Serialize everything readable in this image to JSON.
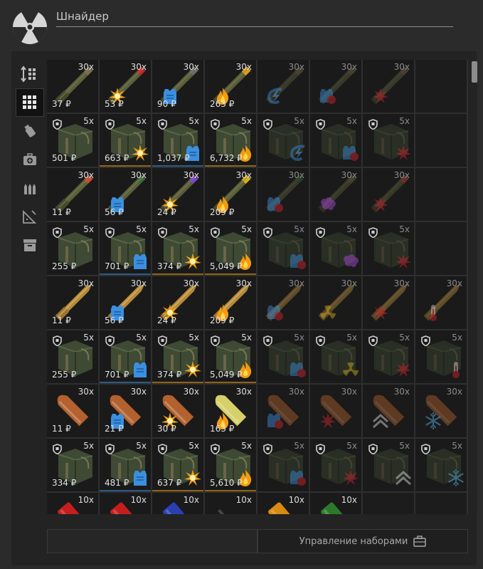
{
  "trader": {
    "name": "Шнайдер",
    "icon": "radiation-icon"
  },
  "sidebar": {
    "items": [
      {
        "name": "sort-icon",
        "active": false
      },
      {
        "name": "grid-view-icon",
        "active": true
      },
      {
        "name": "grenade-icon",
        "active": false
      },
      {
        "name": "medkit-icon",
        "active": false
      },
      {
        "name": "ammo-icon",
        "active": false
      },
      {
        "name": "ruler-icon",
        "active": false
      },
      {
        "name": "archive-icon",
        "active": false
      }
    ]
  },
  "footer": {
    "manage_sets_label": "Управление наборами",
    "icon": "briefcase-icon"
  },
  "colors": {
    "blue": "#3b8fe0",
    "red": "#d8252e",
    "orange": "#f2a012",
    "purple": "#b04be0",
    "yellow": "#d9b21d"
  },
  "grid": [
    {
      "type": "ammo",
      "count": "30x",
      "price": "37 ₽",
      "mod": "",
      "tip": "#7b6a48",
      "locked": false
    },
    {
      "type": "ammo",
      "count": "30x",
      "price": "53 ₽",
      "mod": "burst",
      "tip": "#c82525",
      "locked": false
    },
    {
      "type": "ammo",
      "count": "30x",
      "price": "90 ₽",
      "mod": "armor",
      "tip": "#6b6b6b",
      "locked": false
    },
    {
      "type": "ammo",
      "count": "30x",
      "price": "263 ₽",
      "mod": "fire",
      "tip": "#e0a010",
      "locked": false
    },
    {
      "type": "ammo",
      "count": "30x",
      "price": "",
      "mod": "shock",
      "tip": "#7b6a48",
      "locked": true
    },
    {
      "type": "ammo",
      "count": "30x",
      "price": "",
      "mod": "armor-red",
      "tip": "#7b6a48",
      "locked": true
    },
    {
      "type": "ammo",
      "count": "30x",
      "price": "",
      "mod": "burst-red",
      "tip": "#7b6a48",
      "locked": true
    },
    {
      "type": "empty"
    },
    {
      "type": "box",
      "count": "5x",
      "price": "501 ₽",
      "mod": "",
      "locked": false
    },
    {
      "type": "box",
      "count": "5x",
      "price": "663 ₽",
      "mod": "burst",
      "locked": false
    },
    {
      "type": "box",
      "count": "5x",
      "price": "1,037 ₽",
      "mod": "armor",
      "locked": false
    },
    {
      "type": "box",
      "count": "5x",
      "price": "6,732 ₽",
      "mod": "fire",
      "locked": false
    },
    {
      "type": "box",
      "count": "5x",
      "price": "",
      "mod": "shock",
      "locked": true
    },
    {
      "type": "box",
      "count": "5x",
      "price": "",
      "mod": "armor-red",
      "locked": true
    },
    {
      "type": "box",
      "count": "5x",
      "price": "",
      "mod": "burst-red",
      "locked": true
    },
    {
      "type": "empty"
    },
    {
      "type": "ammo",
      "count": "30x",
      "price": "11 ₽",
      "mod": "",
      "tip": "#c84a2a",
      "locked": false
    },
    {
      "type": "ammo",
      "count": "30x",
      "price": "56 ₽",
      "mod": "armor",
      "tip": "#3a6a3a",
      "locked": false
    },
    {
      "type": "ammo",
      "count": "30x",
      "price": "24 ₽",
      "mod": "burst",
      "tip": "#7a40d0",
      "locked": false
    },
    {
      "type": "ammo",
      "count": "30x",
      "price": "209 ₽",
      "mod": "fire",
      "tip": "#e0b010",
      "locked": false
    },
    {
      "type": "ammo",
      "count": "30x",
      "price": "",
      "mod": "armor-red",
      "tip": "#3a6a3a",
      "locked": true
    },
    {
      "type": "ammo",
      "count": "30x",
      "price": "",
      "mod": "brain",
      "tip": "#7b6a48",
      "locked": true
    },
    {
      "type": "ammo",
      "count": "30x",
      "price": "",
      "mod": "burst-red",
      "tip": "#c84a2a",
      "locked": true
    },
    {
      "type": "empty"
    },
    {
      "type": "box",
      "count": "5x",
      "price": "255 ₽",
      "mod": "",
      "locked": false
    },
    {
      "type": "box",
      "count": "5x",
      "price": "701 ₽",
      "mod": "armor",
      "locked": false
    },
    {
      "type": "box",
      "count": "5x",
      "price": "374 ₽",
      "mod": "burst",
      "locked": false
    },
    {
      "type": "box",
      "count": "5x",
      "price": "5,049 ₽",
      "mod": "fire",
      "locked": false
    },
    {
      "type": "box",
      "count": "5x",
      "price": "",
      "mod": "armor-red",
      "locked": true
    },
    {
      "type": "box",
      "count": "5x",
      "price": "",
      "mod": "brain",
      "locked": true
    },
    {
      "type": "box",
      "count": "5x",
      "price": "",
      "mod": "burst-red",
      "locked": true
    },
    {
      "type": "empty"
    },
    {
      "type": "ammo-brass",
      "count": "30x",
      "price": "11 ₽",
      "mod": "",
      "locked": false
    },
    {
      "type": "ammo-brass",
      "count": "30x",
      "price": "56 ₽",
      "mod": "armor",
      "locked": false
    },
    {
      "type": "ammo-brass",
      "count": "30x",
      "price": "24 ₽",
      "mod": "burst",
      "locked": false
    },
    {
      "type": "ammo-brass",
      "count": "30x",
      "price": "209 ₽",
      "mod": "fire",
      "locked": false
    },
    {
      "type": "ammo-brass",
      "count": "30x",
      "price": "",
      "mod": "armor-red",
      "locked": true
    },
    {
      "type": "ammo-brass",
      "count": "30x",
      "price": "",
      "mod": "radiation",
      "locked": true
    },
    {
      "type": "ammo-brass",
      "count": "30x",
      "price": "",
      "mod": "burst-red",
      "locked": true
    },
    {
      "type": "ammo-brass",
      "count": "30x",
      "price": "",
      "mod": "thermo",
      "locked": true
    },
    {
      "type": "box",
      "count": "5x",
      "price": "255 ₽",
      "mod": "",
      "locked": false
    },
    {
      "type": "box",
      "count": "5x",
      "price": "701 ₽",
      "mod": "armor",
      "locked": false
    },
    {
      "type": "box",
      "count": "5x",
      "price": "374 ₽",
      "mod": "burst",
      "locked": false
    },
    {
      "type": "box",
      "count": "5x",
      "price": "5,049 ₽",
      "mod": "fire",
      "locked": false
    },
    {
      "type": "box",
      "count": "5x",
      "price": "",
      "mod": "armor-red",
      "locked": true
    },
    {
      "type": "box",
      "count": "5x",
      "price": "",
      "mod": "radiation",
      "locked": true
    },
    {
      "type": "box",
      "count": "5x",
      "price": "",
      "mod": "burst-red",
      "locked": true
    },
    {
      "type": "box",
      "count": "5x",
      "price": "",
      "mod": "thermo",
      "locked": true
    },
    {
      "type": "bullet",
      "count": "30x",
      "price": "11 ₽",
      "mod": "",
      "tip": "#b3612e",
      "locked": false
    },
    {
      "type": "bullet",
      "count": "30x",
      "price": "21 ₽",
      "mod": "armor",
      "tip": "#b3612e",
      "locked": false
    },
    {
      "type": "bullet",
      "count": "30x",
      "price": "30 ₽",
      "mod": "burst",
      "tip": "#b3612e",
      "locked": false
    },
    {
      "type": "bullet",
      "count": "30x",
      "price": "163 ₽",
      "mod": "fire",
      "tip": "#d5d06a",
      "locked": false
    },
    {
      "type": "bullet",
      "count": "30x",
      "price": "",
      "mod": "armor-red",
      "tip": "#b3612e",
      "locked": true
    },
    {
      "type": "bullet",
      "count": "30x",
      "price": "",
      "mod": "burst-red",
      "tip": "#b3612e",
      "locked": true
    },
    {
      "type": "bullet",
      "count": "30x",
      "price": "",
      "mod": "chevron",
      "tip": "#b3612e",
      "locked": true
    },
    {
      "type": "bullet",
      "count": "30x",
      "price": "",
      "mod": "snow",
      "tip": "#b3612e",
      "locked": true
    },
    {
      "type": "box",
      "count": "5x",
      "price": "334 ₽",
      "mod": "",
      "locked": false
    },
    {
      "type": "box",
      "count": "5x",
      "price": "481 ₽",
      "mod": "armor",
      "locked": false
    },
    {
      "type": "box",
      "count": "5x",
      "price": "637 ₽",
      "mod": "burst",
      "locked": false
    },
    {
      "type": "box",
      "count": "5x",
      "price": "5,610 ₽",
      "mod": "fire",
      "locked": false
    },
    {
      "type": "box",
      "count": "5x",
      "price": "",
      "mod": "armor-red",
      "locked": true
    },
    {
      "type": "box",
      "count": "5x",
      "price": "",
      "mod": "burst-red",
      "locked": true
    },
    {
      "type": "box",
      "count": "5x",
      "price": "",
      "mod": "chevron",
      "locked": true
    },
    {
      "type": "box",
      "count": "5x",
      "price": "",
      "mod": "snow",
      "locked": true
    },
    {
      "type": "shell",
      "count": "10x",
      "price": "",
      "mod": "",
      "tip": "#c41e1e",
      "locked": false
    },
    {
      "type": "shell",
      "count": "10x",
      "price": "",
      "mod": "",
      "tip": "#c41e1e",
      "locked": false
    },
    {
      "type": "shell",
      "count": "10x",
      "price": "",
      "mod": "",
      "tip": "#2a3fb0",
      "locked": false
    },
    {
      "type": "shell",
      "count": "10x",
      "price": "",
      "mod": "",
      "tip": "#1a1a1a",
      "locked": false
    },
    {
      "type": "shell",
      "count": "10x",
      "price": "",
      "mod": "",
      "tip": "#d98a10",
      "locked": false
    },
    {
      "type": "shell",
      "count": "10x",
      "price": "",
      "mod": "",
      "tip": "#2a7a2a",
      "locked": false
    },
    {
      "type": "empty"
    },
    {
      "type": "empty"
    }
  ]
}
